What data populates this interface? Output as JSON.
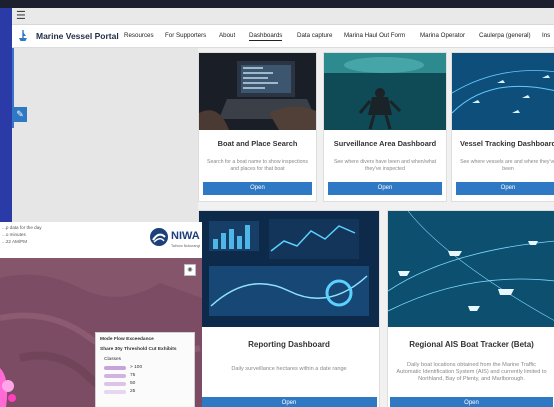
{
  "colors": {
    "accent": "#2f78c4",
    "desktop_blue": "#3f4fb8"
  },
  "portal": {
    "menu_icon": "hamburger-icon",
    "logo_icon": "vessel-icon",
    "title": "Marine Vessel Portal",
    "nav": [
      "Resources",
      "For Supporters",
      "About",
      "Dashboards",
      "Data capture",
      "Marina Haul Out Form",
      "Marina Operator",
      "Caulerpa (general)",
      "Ins"
    ],
    "active_nav": "Dashboards",
    "edit_icon": "pencil-icon"
  },
  "cards_row1": [
    {
      "title": "Boat and Place Search",
      "desc": "Search for a boat name to show inspections and places for that boat",
      "button": "Open"
    },
    {
      "title": "Surveillance Area Dashboard",
      "desc": "See where divers have been and when/what they've inspected",
      "button": "Open"
    },
    {
      "title": "Vessel Tracking Dashboard",
      "desc": "See where vessels are and where they've been",
      "button": "Open"
    }
  ],
  "cards_row2": [
    {
      "title": "Reporting Dashboard",
      "desc": "Daily surveillance hectares within a date range",
      "button": "Open"
    },
    {
      "title": "Regional AIS Boat Tracker (Beta)",
      "desc": "Daily boat locations obtained from the Marine Traffic Automatic Identification System (AIS) and currently limited to Northland, Bay of Plenty, and Marlborough.",
      "button": "Open"
    }
  ],
  "map_window": {
    "meta": [
      "...p data for the day",
      "...o minutes",
      "...22 AM/PM"
    ],
    "logo_text": "NIWA",
    "logo_sub": "Taihoro Nukurangi",
    "legend_title": "Mode Flow Exceedance",
    "legend_subtitle": "Share 30y Threshold Cut Exhibits",
    "legend_heading": "Classes",
    "legend_items": [
      "> 100",
      "75",
      "50",
      "25"
    ],
    "zoom_icon": "layers-icon"
  }
}
